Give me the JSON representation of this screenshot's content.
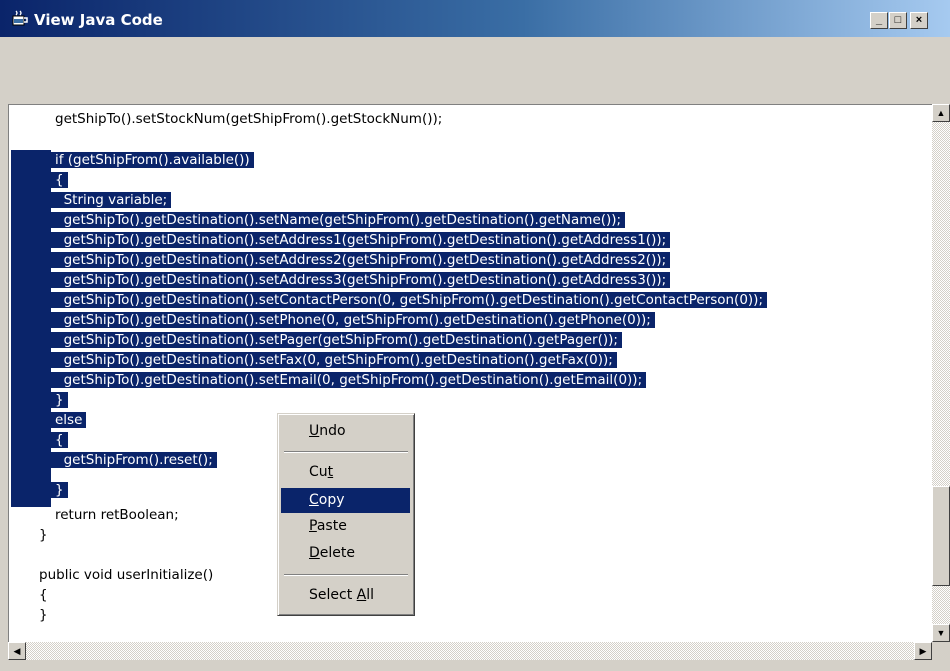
{
  "window": {
    "title": "View Java Code",
    "controls": [
      "_",
      "□",
      "×"
    ]
  },
  "code_lines": [
    "getShipTo().setStockNum(getShipFrom().getStockNum());",
    "",
    "if (getShipFrom().available())",
    "{",
    "  String variable;",
    "  getShipTo().getDestination().setName(getShipFrom().getDestination().getName());",
    "  getShipTo().getDestination().setAddress1(getShipFrom().getDestination().getAddress1());",
    "  getShipTo().getDestination().setAddress2(getShipFrom().getDestination().getAddress2());",
    "  getShipTo().getDestination().setAddress3(getShipFrom().getDestination().getAddress3());",
    "  getShipTo().getDestination().setContactPerson(0, getShipFrom().getDestination().getContactPerson(0));",
    "  getShipTo().getDestination().setPhone(0, getShipFrom().getDestination().getPhone(0));",
    "  getShipTo().getDestination().setPager(getShipFrom().getDestination().getPager());",
    "  getShipTo().getDestination().setFax(0, getShipFrom().getDestination().getFax(0));",
    "  getShipTo().getDestination().setEmail(0, getShipFrom().getDestination().getEmail(0));",
    "}",
    "else",
    "{",
    "  getShipFrom().reset();",
    "}",
    "return retBoolean;",
    "}",
    "",
    "public void userInitialize()",
    "{",
    "}"
  ],
  "context_menu": {
    "items": [
      {
        "label": "Undo",
        "accel": "U"
      },
      {
        "label": "Cut",
        "accel": "t"
      },
      {
        "label": "Copy",
        "accel": "C",
        "highlighted": true
      },
      {
        "label": "Paste",
        "accel": "P"
      },
      {
        "label": "Delete",
        "accel": "D"
      },
      {
        "label": "Select All",
        "accel": "A"
      }
    ]
  },
  "colors": {
    "selection": "#0a246a",
    "title_start": "#0a246a",
    "title_end": "#a6caf0",
    "chrome": "#d4d0c8"
  },
  "icons": [
    "java-cup-icon",
    "minimize-icon",
    "maximize-icon",
    "close-icon",
    "scroll-up-icon",
    "scroll-down-icon",
    "scroll-left-icon",
    "scroll-right-icon"
  ]
}
